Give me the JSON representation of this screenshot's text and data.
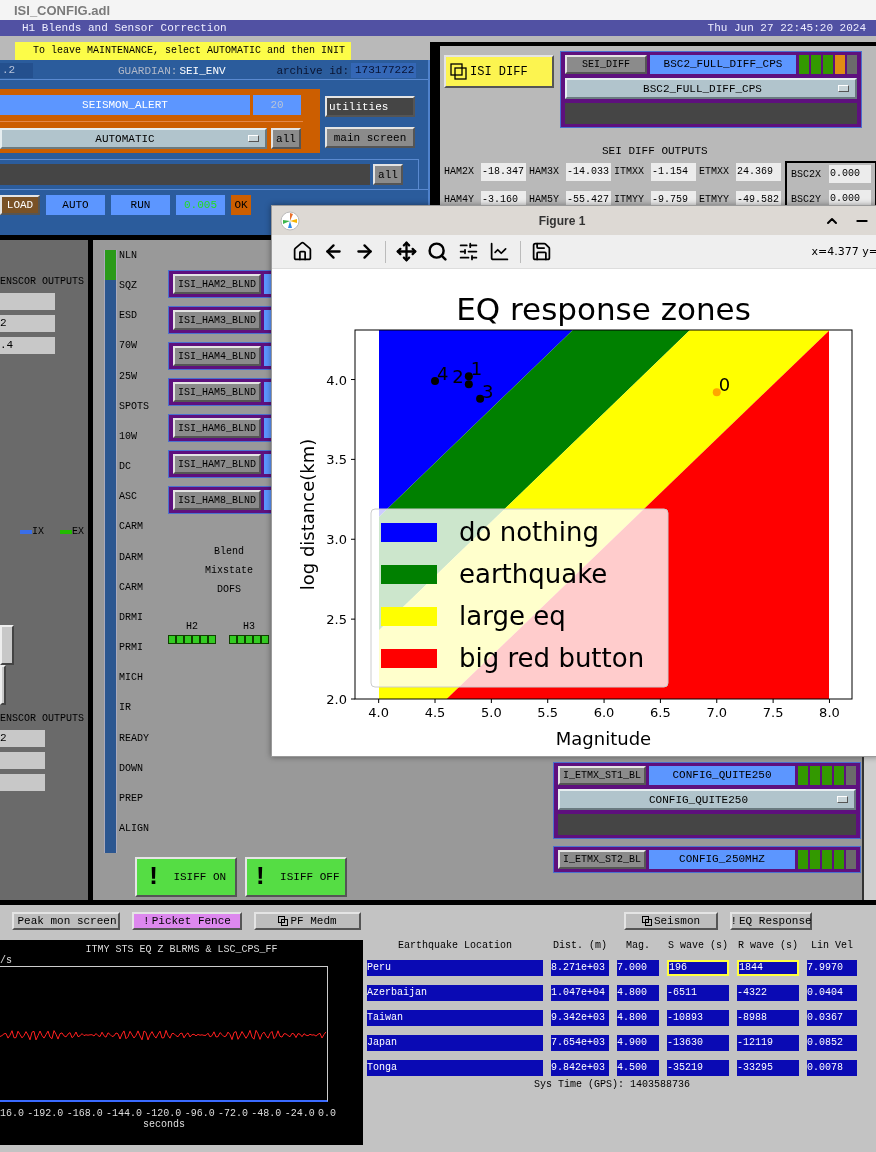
{
  "window": {
    "title": "ISI_CONFIG.adl"
  },
  "header": {
    "title": "H1 Blends and Sensor Correction",
    "datetime": "Thu Jun 27 22:45:20 2024"
  },
  "guardian": {
    "banner": "To leave MAINTENANCE, select AUTOMATIC and then INIT",
    "version": ".2",
    "guardian_label": "GUARDIAN:",
    "node": "SEI_ENV",
    "archive_label": "archive id:",
    "archive_id": "173177222",
    "state": "SEISMON_ALERT",
    "state_index": "20",
    "mode": "AUTOMATIC",
    "mode_all": "all",
    "message_all": "all",
    "links": [
      "utilities",
      "main screen"
    ],
    "status_row": [
      {
        "kind": "button",
        "text": "LOAD"
      },
      {
        "kind": "mode",
        "text": "AUTO"
      },
      {
        "kind": "mode",
        "text": "RUN"
      },
      {
        "kind": "reading",
        "text": "0.005"
      },
      {
        "kind": "ok",
        "text": "OK"
      }
    ]
  },
  "isi_diff": {
    "button": "ISI DIFF",
    "node": "SEI_DIFF",
    "state": "BSC2_FULL_DIFF_CPS",
    "request": "BSC2_FULL_DIFF_CPS",
    "indicators": [
      {
        "color": "#339900"
      },
      {
        "color": "#339900"
      },
      {
        "color": "#339900"
      },
      {
        "color": "#e08c14"
      },
      {
        "color": "#6b6b6b"
      }
    ],
    "outputs_title": "SEI DIFF OUTPUTS",
    "outputs": [
      {
        "label": "HAM2X",
        "value": "-18.347"
      },
      {
        "label": "HAM3X",
        "value": "-14.033"
      },
      {
        "label": "ITMXX",
        "value": "-1.154"
      },
      {
        "label": "ETMXX",
        "value": "24.369"
      },
      {
        "label": "HAM4Y",
        "value": "-3.160"
      },
      {
        "label": "HAM5Y",
        "value": "-55.427"
      },
      {
        "label": "ITMYY",
        "value": "-9.759"
      },
      {
        "label": "ETMYY",
        "value": "-49.582"
      }
    ],
    "bsc_outputs": [
      {
        "label": "BSC2X",
        "value": "0.000"
      },
      {
        "label": "BSC2Y",
        "value": "0.000"
      }
    ]
  },
  "sensor_outputs": [
    {
      "title": "ENSCOR OUTPUTS",
      "fields": [
        {
          "kind": "blank"
        },
        {
          "kind": "value",
          "value": "2"
        },
        {
          "kind": "value",
          "value": ".4"
        }
      ]
    },
    {
      "title": "ENSCOR OUTPUTS",
      "fields": [
        {
          "kind": "value",
          "value": "2"
        },
        {
          "kind": "blank"
        },
        {
          "kind": "blank"
        }
      ]
    }
  ],
  "markers": [
    {
      "label": "IX",
      "color": "#3a6ee8"
    },
    {
      "label": "EX",
      "color": "#22bb00"
    }
  ],
  "state_ladder": [
    {
      "label": "NLN",
      "selected": true
    },
    {
      "label": "SQZ",
      "selected": false
    },
    {
      "label": "ESD",
      "selected": false
    },
    {
      "label": "70W",
      "selected": false
    },
    {
      "label": "25W",
      "selected": false
    },
    {
      "label": "SPOTS",
      "selected": false
    },
    {
      "label": "10W",
      "selected": false
    },
    {
      "label": "DC",
      "selected": false
    },
    {
      "label": "ASC",
      "selected": false
    },
    {
      "label": "CARM",
      "selected": false
    },
    {
      "label": "DARM",
      "selected": false
    },
    {
      "label": "CARM",
      "selected": false
    },
    {
      "label": "DRMI",
      "selected": false
    },
    {
      "label": "PRMI",
      "selected": false
    },
    {
      "label": "MICH",
      "selected": false
    },
    {
      "label": "IR",
      "selected": false
    },
    {
      "label": "READY",
      "selected": false
    },
    {
      "label": "DOWN",
      "selected": false
    },
    {
      "label": "PREP",
      "selected": false
    },
    {
      "label": "ALIGN",
      "selected": false
    }
  ],
  "blend_nodes": [
    "ISI_HAM2_BLND",
    "ISI_HAM3_BLND",
    "ISI_HAM4_BLND",
    "ISI_HAM5_BLND",
    "ISI_HAM6_BLND",
    "ISI_HAM7_BLND",
    "ISI_HAM8_BLND"
  ],
  "blend_labels": [
    "Blend",
    "Mixstate",
    "DOFS"
  ],
  "mixstate": [
    {
      "label": "H2",
      "lights": [
        {
          "on": true
        },
        {
          "on": true
        },
        {
          "on": true
        },
        {
          "on": true
        },
        {
          "on": true
        },
        {
          "on": true
        }
      ]
    },
    {
      "label": "H3",
      "lights": [
        {
          "on": true
        },
        {
          "on": true
        },
        {
          "on": true
        },
        {
          "on": true
        },
        {
          "on": true
        }
      ]
    }
  ],
  "isiff_buttons": [
    {
      "mark": "!",
      "label": "ISIFF ON"
    },
    {
      "mark": "!",
      "label": "ISIFF OFF"
    }
  ],
  "etmx": [
    {
      "node": "I_ETMX_ST1_BL",
      "state": "CONFIG_QUITE250",
      "request": "CONFIG_QUITE250",
      "indicators": [
        {
          "color": "#339900"
        },
        {
          "color": "#339900"
        },
        {
          "color": "#339900"
        },
        {
          "color": "#339900"
        },
        {
          "color": "#6b6b6b"
        }
      ]
    },
    {
      "node": "I_ETMX_ST2_BL",
      "state": "CONFIG_250MHZ",
      "indicators": [
        {
          "color": "#339900"
        },
        {
          "color": "#339900"
        },
        {
          "color": "#339900"
        },
        {
          "color": "#339900"
        },
        {
          "color": "#6b6b6b"
        }
      ]
    }
  ],
  "figure": {
    "title": "Figure 1",
    "coords": "x=4.377 y=",
    "chart_data": {
      "type": "scatter",
      "title": "EQ response zones",
      "xlabel": "Magnitude",
      "ylabel": "log distance(km)",
      "x": [
        7.0,
        4.8,
        4.8,
        4.9,
        4.5
      ],
      "series": [
        {
          "name": "0",
          "color": "#ffa500",
          "values": [
            3.92,
            null,
            null,
            null,
            null
          ]
        },
        {
          "name": "1",
          "color": "#000000",
          "values": [
            null,
            4.02,
            null,
            null,
            null
          ]
        },
        {
          "name": "2",
          "color": "#000000",
          "values": [
            null,
            null,
            3.97,
            null,
            null
          ]
        },
        {
          "name": "3",
          "color": "#000000",
          "values": [
            null,
            null,
            null,
            3.88,
            null
          ]
        },
        {
          "name": "4",
          "color": "#000000",
          "values": [
            null,
            null,
            null,
            null,
            3.99
          ]
        }
      ],
      "legend": {
        "entries": [
          {
            "label": "do nothing",
            "color": "#0000ff"
          },
          {
            "label": "earthquake",
            "color": "#008000"
          },
          {
            "label": "large eq",
            "color": "#ffff00"
          },
          {
            "label": "big red button",
            "color": "#ff0000"
          }
        ]
      },
      "xlim": [
        3.79,
        8.2
      ],
      "ylim": [
        2.0,
        4.31
      ],
      "xticks": [
        {
          "value": 4.0,
          "label": "4.0"
        },
        {
          "value": 4.5,
          "label": "4.5"
        },
        {
          "value": 5.0,
          "label": "5.0"
        },
        {
          "value": 5.5,
          "label": "5.5"
        },
        {
          "value": 6.0,
          "label": "6.0"
        },
        {
          "value": 6.5,
          "label": "6.5"
        },
        {
          "value": 7.0,
          "label": "7.0"
        },
        {
          "value": 7.5,
          "label": "7.5"
        },
        {
          "value": 8.0,
          "label": "8.0"
        }
      ],
      "yticks": [
        {
          "value": 2.0,
          "label": "2.0"
        },
        {
          "value": 2.5,
          "label": "2.5"
        },
        {
          "value": 3.0,
          "label": "3.0"
        },
        {
          "value": 3.5,
          "label": "3.5"
        },
        {
          "value": 4.0,
          "label": "4.0"
        }
      ]
    }
  },
  "bottom": {
    "left_buttons": [
      {
        "kind": "display",
        "label": "Peak mon screen",
        "color": "#bdbdbd"
      },
      {
        "kind": "command",
        "mark": "!",
        "label": "Picket Fence",
        "color": "#dd88ee"
      },
      {
        "kind": "display",
        "label": "PF Medm",
        "color": "#bdbdbd"
      }
    ],
    "right_buttons": [
      {
        "kind": "display",
        "label": "Seismon",
        "color": "#bdbdbd"
      },
      {
        "kind": "command",
        "mark": "!",
        "label": "EQ Response",
        "color": "#bdbdbd"
      }
    ]
  },
  "plot": {
    "title": "ITMY STS EQ Z BLRMS & LSC_CPS_FF",
    "unit": "/s",
    "xticks": [
      "16.0",
      "-192.0",
      "-168.0",
      "-144.0",
      "-120.0",
      "-96.0",
      "-72.0",
      "-48.0",
      "-24.0",
      "0.0"
    ],
    "xlabel": "seconds"
  },
  "eq_table": {
    "columns": [
      "Earthquake Location",
      "Dist. (m)",
      "Mag.",
      "S wave (s)",
      "R wave (s)",
      "Lin Vel"
    ],
    "rows": [
      {
        "cells": [
          "Peru",
          "8.271e+03",
          "7.000",
          "196",
          "1844",
          "7.9970"
        ],
        "arriving": true
      },
      {
        "cells": [
          "Azerbaijan",
          "1.047e+04",
          "4.800",
          "-6511",
          "-4322",
          "0.0404"
        ],
        "arriving": false
      },
      {
        "cells": [
          "Taiwan",
          "9.342e+03",
          "4.800",
          "-10893",
          "-8988",
          "0.0367"
        ],
        "arriving": false
      },
      {
        "cells": [
          "Japan",
          "7.654e+03",
          "4.900",
          "-13630",
          "-12119",
          "0.0852"
        ],
        "arriving": false
      },
      {
        "cells": [
          "Tonga",
          "9.842e+03",
          "4.500",
          "-35219",
          "-33295",
          "0.0078"
        ],
        "arriving": false
      }
    ],
    "sys_time_label": "Sys Time (GPS):",
    "sys_time": "1403588736"
  }
}
